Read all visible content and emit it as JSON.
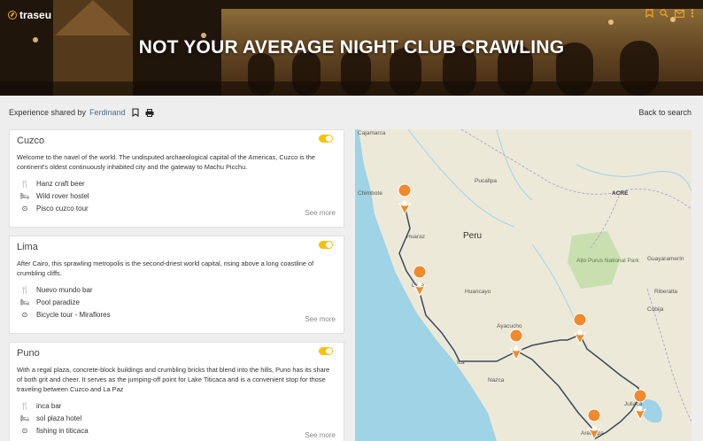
{
  "brand": {
    "name": "traseu"
  },
  "hero": {
    "title": "NOT YOUR AVERAGE NIGHT CLUB CRAWLING",
    "tools": [
      "bookmark-icon",
      "search-icon",
      "mail-icon",
      "more-icon"
    ]
  },
  "subheader": {
    "shared_prefix": "Experience shared by",
    "author": "Ferdinand",
    "back_label": "Back to search"
  },
  "cards": [
    {
      "title": "Cuzco",
      "enabled": true,
      "description": "Welcome to the navel of the world. The undisputed archaeological capital of the Americas, Cuzco is the continent's oldest continuously inhabited city and the gateway to Machu Picchu.",
      "items": [
        {
          "icon": "fork-knife-icon",
          "label": "Hanz craft beer"
        },
        {
          "icon": "bed-icon",
          "label": "Wild rover hostel"
        },
        {
          "icon": "binoculars-icon",
          "label": "Pisco cuzco tour"
        }
      ],
      "more_label": "See more"
    },
    {
      "title": "Lima",
      "enabled": true,
      "description": "After Cairo, this sprawling metropolis is the second-driest world capital, rising above a long coastline of crumbling cliffs.",
      "items": [
        {
          "icon": "fork-knife-icon",
          "label": "Nuevo mundo bar"
        },
        {
          "icon": "bed-icon",
          "label": "Pool paradize"
        },
        {
          "icon": "binoculars-icon",
          "label": "Bicycle tour - Miraflores"
        }
      ],
      "more_label": "See more"
    },
    {
      "title": "Puno",
      "enabled": true,
      "description": "With a regal plaza, concrete-block buildings and crumbling bricks that blend into the hills, Puno has its share of both grit and cheer. It serves as the jumping-off point for Lake Titicaca and is a convenient stop for those traveling between Cuzco and La Paz",
      "items": [
        {
          "icon": "fork-knife-icon",
          "label": "inca bar"
        },
        {
          "icon": "bed-icon",
          "label": "sol plaza hotel"
        },
        {
          "icon": "binoculars-icon",
          "label": "fishing in titicaca"
        }
      ],
      "more_label": "See more"
    }
  ],
  "map": {
    "labels": {
      "country": "Peru",
      "acre": "ACRE",
      "chimbote": "Chimbote",
      "huaraz": "Huaraz",
      "lima": "Lima",
      "huancayo": "Huancayo",
      "ayacucho": "Ayacucho",
      "ica": "Ica",
      "nazca": "Nazca",
      "arequipa": "Arequipa",
      "juliaca": "Juliaca",
      "park": "Alto Purus National Park",
      "riberalta": "Riberalta",
      "guayaramerin": "Guayaramerín",
      "cobija": "Cobija",
      "pucallpa": "Pucallpa",
      "cajamarca": "Cajamarca"
    },
    "colors": {
      "land": "#ede9d9",
      "water": "#9fd3e6",
      "route": "#3a4a5a",
      "pin": "#f08a2c",
      "park": "#c8dfb0"
    }
  }
}
